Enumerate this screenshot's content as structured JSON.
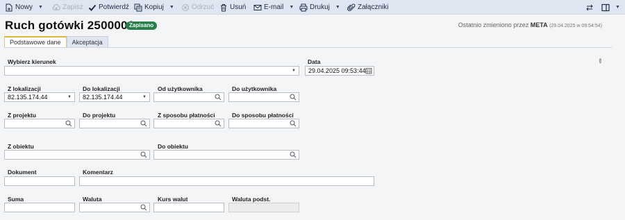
{
  "toolbar": {
    "new": "Nowy",
    "save": "Zapisz",
    "confirm": "Potwierdź",
    "copy": "Kopiuj",
    "reject": "Odrzuć",
    "delete": "Usuń",
    "email": "E-mail",
    "print": "Drukuj",
    "attachments": "Załączniki"
  },
  "header": {
    "title": "Ruch gotówki 2500001",
    "status": "Zapisano",
    "lastmod_prefix": "Ostatnio zmieniono przez ",
    "lastmod_user": "META",
    "lastmod_time": "(29.04.2025 w 09:54:54)"
  },
  "tabs": [
    "Podstawowe dane",
    "Akceptacja"
  ],
  "form": {
    "direction": {
      "label": "Wybierz kierunek",
      "value": ""
    },
    "date": {
      "label": "Data",
      "value": "29.04.2025 09:53:44"
    },
    "from_location": {
      "label": "Z lokalizacji",
      "value": "82.135.174.44"
    },
    "to_location": {
      "label": "Do lokalizacji",
      "value": "82.135.174.44"
    },
    "from_user": {
      "label": "Od użytkownika",
      "value": ""
    },
    "to_user": {
      "label": "Do użytkownika",
      "value": ""
    },
    "from_project": {
      "label": "Z projektu",
      "value": ""
    },
    "to_project": {
      "label": "Do projektu",
      "value": ""
    },
    "from_payment": {
      "label": "Z sposobu płatności",
      "value": ""
    },
    "to_payment": {
      "label": "Do sposobu płatności",
      "value": ""
    },
    "from_object": {
      "label": "Z obiektu",
      "value": ""
    },
    "to_object": {
      "label": "Do obiektu",
      "value": ""
    },
    "document": {
      "label": "Dokument",
      "value": ""
    },
    "comment": {
      "label": "Komentarz",
      "value": ""
    },
    "sum": {
      "label": "Suma",
      "value": ""
    },
    "currency": {
      "label": "Waluta",
      "value": ""
    },
    "exchange_rate": {
      "label": "Kurs walut",
      "value": ""
    },
    "base_currency": {
      "label": "Waluta podst.",
      "value": ""
    }
  }
}
